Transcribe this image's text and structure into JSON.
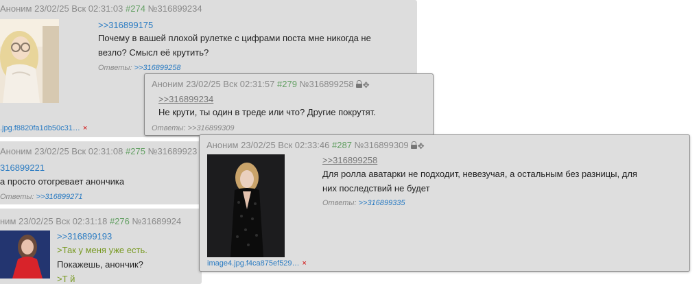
{
  "posts": [
    {
      "author": "Аноним",
      "date": "23/02/25 Вск 02:31:03",
      "num": "#274",
      "no": "№316899234",
      "reply": ">>316899175",
      "text": [
        "Почему в вашей плохой рулетке с цифрами поста мне никогда не",
        "везло? Смысл её крутить?"
      ],
      "answers_label": "Ответы:",
      "answers": ">>316899258",
      "file": ".jpg.f8820fa1db50c31…",
      "file_remove": "×"
    },
    {
      "author": "Аноним",
      "date": "23/02/25 Вск 02:31:08",
      "num": "#275",
      "no": "№31689923",
      "reply": "316899221",
      "text": [
        "а просто отогревает анончика"
      ],
      "answers_label": "Ответы:",
      "answers": ">>316899271"
    },
    {
      "author": "ним",
      "date": "23/02/25 Вск 02:31:18",
      "num": "#276",
      "no": "№31689924",
      "reply": ">>316899193",
      "quote": ">Так у меня уже есть.",
      "text": [
        "Покажешь, анончик?"
      ],
      "quote2": ">Т й"
    }
  ],
  "popups": [
    {
      "author": "Аноним",
      "date": "23/02/25 Вск 02:31:57",
      "num": "#279",
      "no": "№316899258",
      "reply": ">>316899234",
      "text": [
        "Не крути, ты один в треде или что? Другие покрутят."
      ],
      "answers_label": "Ответы:",
      "answers": ">>316899309"
    },
    {
      "author": "Аноним",
      "date": "23/02/25 Вск 02:33:46",
      "num": "#287",
      "no": "№316899309",
      "reply": ">>316899258",
      "text": [
        "Для ролла аватарки не подходит, невезучая, а остальным без разницы, для",
        "них последствий не будет"
      ],
      "answers_label": "Ответы:",
      "answers": ">>316899335",
      "file": "image4.jpg.f4ca875ef529…",
      "file_remove": "×"
    }
  ],
  "colors": {
    "post_bg": "#dddddd",
    "link": "#2a7bc2",
    "post_number": "#64a064",
    "greentext": "#789922",
    "remove": "#d00000"
  },
  "icons": [
    "lock-icon",
    "move-icon"
  ]
}
